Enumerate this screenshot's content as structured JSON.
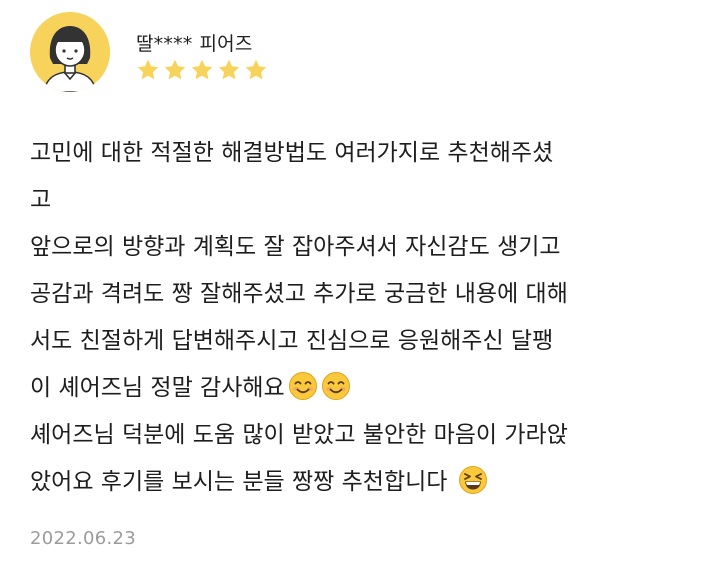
{
  "reviewer": {
    "nickname": "딸****",
    "label": "피어즈",
    "rating": 5,
    "avatar_bg": "#f7d35c",
    "star_color": "#f7d35c"
  },
  "review": {
    "lines": [
      "고민에 대한 적절한 해결방법도 여러가지로 추천해주셨",
      "고",
      "앞으로의 방향과 계획도 잘 잡아주셔서 자신감도 생기고",
      "공감과 격려도 짱 잘해주셨고 추가로 궁금한 내용에 대해",
      "서도 친절하게 답변해주시고 진심으로 응원해주신 달팽",
      "이 셰어즈님 정말 감사해요",
      "셰어즈님 덕분에 도움 많이 받았고 불안한 마음이 가라앉",
      "았어요 후기를 보시는 분들 짱짱 추천합니다 "
    ],
    "emojis": [
      "smiling-face-emoji",
      "smiling-face-emoji",
      "grinning-squinting-face-emoji"
    ]
  },
  "date": "2022.06.23"
}
